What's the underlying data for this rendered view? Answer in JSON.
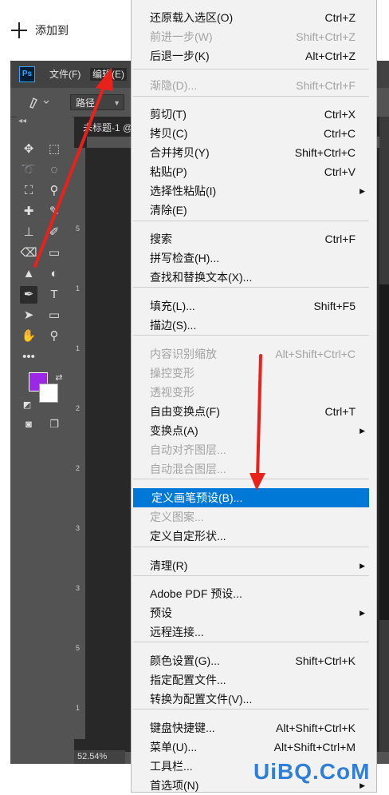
{
  "add_bar": {
    "label": "添加到"
  },
  "ps": {
    "menus": [
      "文件(F)",
      "编辑(E)"
    ],
    "option_bar": {
      "mode": "路径"
    },
    "tab_title": "未标题-1 @",
    "zoom": "52.54%",
    "ruler_numbers": [
      "5",
      "1",
      "1",
      "2",
      "2",
      "3",
      "3",
      "5",
      "1"
    ],
    "colors": {
      "foreground": "#9c27e6",
      "background": "#ffffff"
    }
  },
  "menu": {
    "items": [
      {
        "label": "还原载入选区(O)",
        "shortcut": "Ctrl+Z",
        "disabled": false
      },
      {
        "label": "前进一步(W)",
        "shortcut": "Shift+Ctrl+Z",
        "disabled": true
      },
      {
        "label": "后退一步(K)",
        "shortcut": "Alt+Ctrl+Z",
        "disabled": false
      },
      {
        "label": "渐隐(D)...",
        "shortcut": "Shift+Ctrl+F",
        "disabled": true
      },
      {
        "label": "剪切(T)",
        "shortcut": "Ctrl+X",
        "disabled": false
      },
      {
        "label": "拷贝(C)",
        "shortcut": "Ctrl+C",
        "disabled": false
      },
      {
        "label": "合并拷贝(Y)",
        "shortcut": "Shift+Ctrl+C",
        "disabled": false
      },
      {
        "label": "粘贴(P)",
        "shortcut": "Ctrl+V",
        "disabled": false
      },
      {
        "label": "选择性粘贴(I)",
        "shortcut": "",
        "disabled": false,
        "submenu": true
      },
      {
        "label": "清除(E)",
        "shortcut": "",
        "disabled": false
      },
      {
        "label": "搜索",
        "shortcut": "Ctrl+F",
        "disabled": false
      },
      {
        "label": "拼写检查(H)...",
        "shortcut": "",
        "disabled": false
      },
      {
        "label": "查找和替换文本(X)...",
        "shortcut": "",
        "disabled": false
      },
      {
        "label": "填充(L)...",
        "shortcut": "Shift+F5",
        "disabled": false
      },
      {
        "label": "描边(S)...",
        "shortcut": "",
        "disabled": false
      },
      {
        "label": "内容识别缩放",
        "shortcut": "Alt+Shift+Ctrl+C",
        "disabled": true
      },
      {
        "label": "操控变形",
        "shortcut": "",
        "disabled": true
      },
      {
        "label": "透视变形",
        "shortcut": "",
        "disabled": true
      },
      {
        "label": "自由变换点(F)",
        "shortcut": "Ctrl+T",
        "disabled": false
      },
      {
        "label": "变换点(A)",
        "shortcut": "",
        "disabled": false,
        "submenu": true
      },
      {
        "label": "自动对齐图层...",
        "shortcut": "",
        "disabled": true
      },
      {
        "label": "自动混合图层...",
        "shortcut": "",
        "disabled": true
      },
      {
        "label": "定义画笔预设(B)...",
        "shortcut": "",
        "disabled": false,
        "highlighted": true
      },
      {
        "label": "定义图案...",
        "shortcut": "",
        "disabled": true
      },
      {
        "label": "定义自定形状...",
        "shortcut": "",
        "disabled": false
      },
      {
        "label": "清理(R)",
        "shortcut": "",
        "disabled": false,
        "submenu": true
      },
      {
        "label": "Adobe PDF 预设...",
        "shortcut": "",
        "disabled": false
      },
      {
        "label": "预设",
        "shortcut": "",
        "disabled": false,
        "submenu": true
      },
      {
        "label": "远程连接...",
        "shortcut": "",
        "disabled": false
      },
      {
        "label": "颜色设置(G)...",
        "shortcut": "Shift+Ctrl+K",
        "disabled": false
      },
      {
        "label": "指定配置文件...",
        "shortcut": "",
        "disabled": false
      },
      {
        "label": "转换为配置文件(V)...",
        "shortcut": "",
        "disabled": false
      },
      {
        "label": "键盘快捷键...",
        "shortcut": "Alt+Shift+Ctrl+K",
        "disabled": false
      },
      {
        "label": "菜单(U)...",
        "shortcut": "Alt+Shift+Ctrl+M",
        "disabled": false
      },
      {
        "label": "工具栏...",
        "shortcut": "",
        "disabled": false
      },
      {
        "label": "首选项(N)",
        "shortcut": "",
        "disabled": false,
        "submenu": true
      }
    ]
  },
  "watermark": "UiBQ.CoM",
  "accent_colors": {
    "highlight": "#0078d7",
    "arrow": "#e8211a"
  }
}
